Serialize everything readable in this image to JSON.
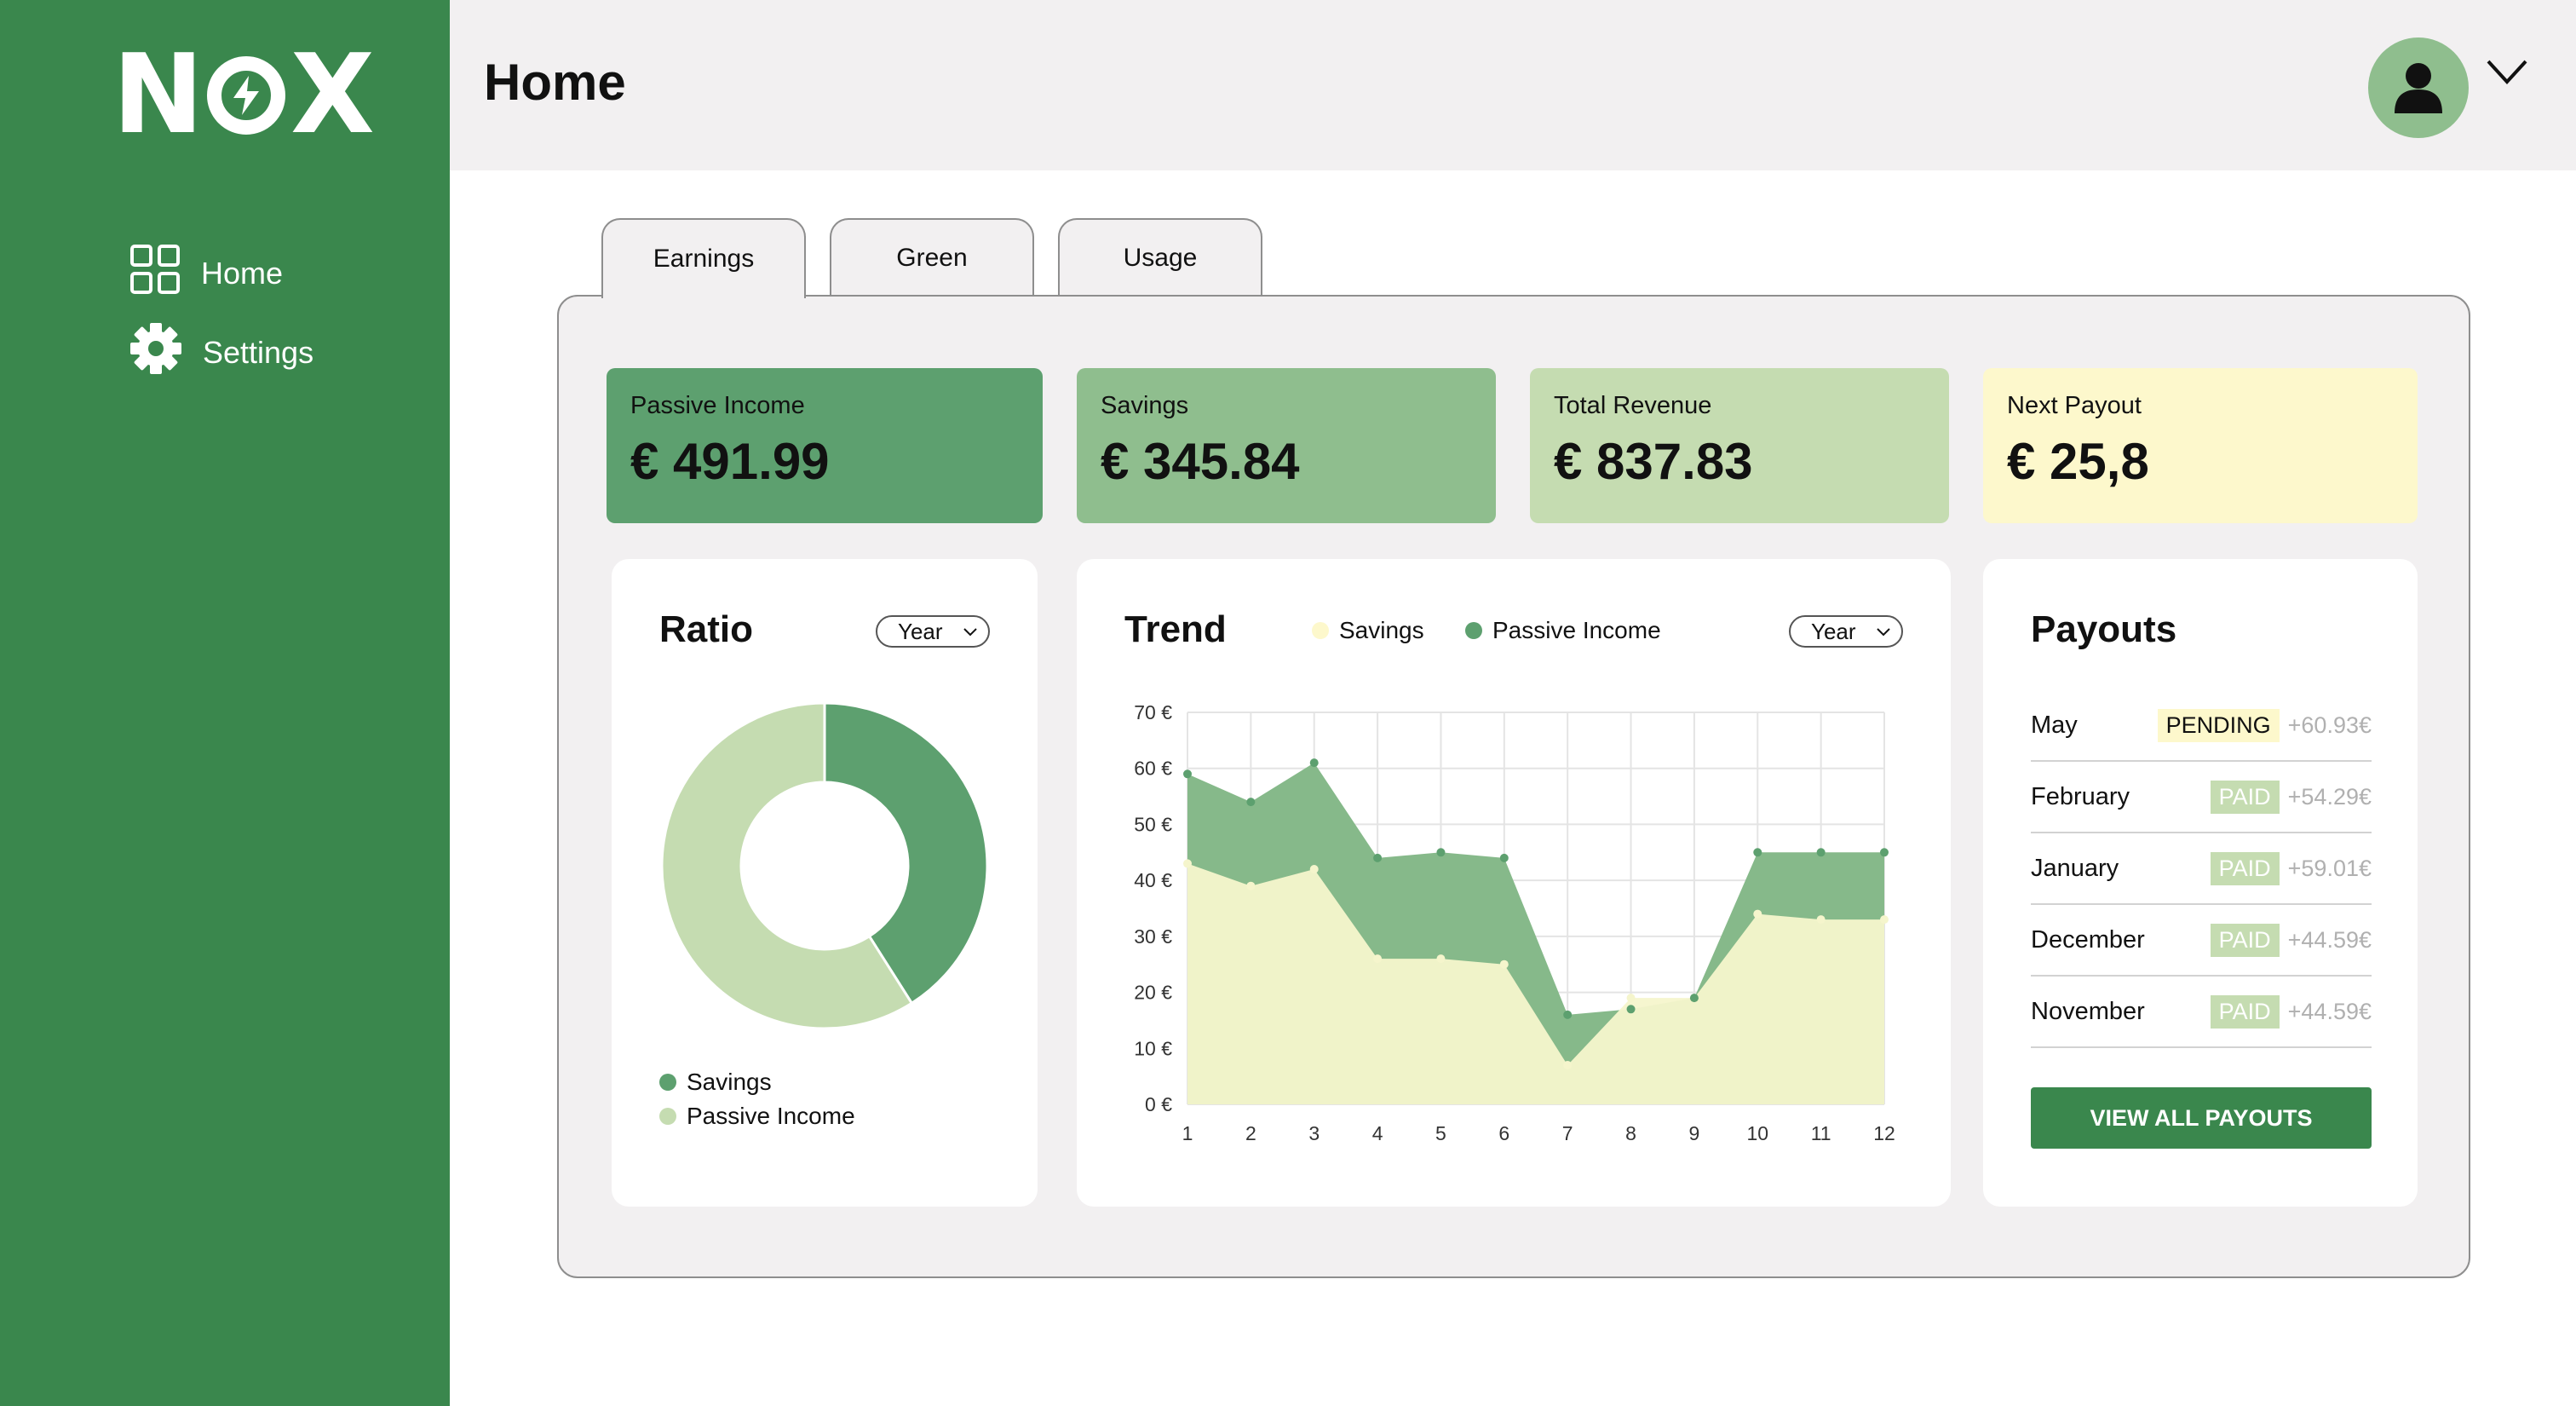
{
  "sidebar": {
    "logo": {
      "left": "N",
      "right": "X"
    },
    "items": [
      {
        "label": "Home",
        "icon": "grid-icon"
      },
      {
        "label": "Settings",
        "icon": "gear-icon"
      }
    ]
  },
  "header": {
    "title": "Home",
    "avatar_icon": "user-icon",
    "menu_icon": "chevron-down-icon"
  },
  "tabs": [
    {
      "label": "Earnings",
      "active": true
    },
    {
      "label": "Green",
      "active": false
    },
    {
      "label": "Usage",
      "active": false
    }
  ],
  "stats": [
    {
      "label": "Passive Income",
      "value": "€ 491.99"
    },
    {
      "label": "Savings",
      "value": "€ 345.84"
    },
    {
      "label": "Total Revenue",
      "value": "€ 837.83"
    },
    {
      "label": "Next Payout",
      "value": "€ 25,8"
    }
  ],
  "ratio": {
    "title": "Ratio",
    "period": "Year"
  },
  "trend": {
    "title": "Trend",
    "period": "Year"
  },
  "colors": {
    "savings": "#f5f5cc",
    "passive_income": "#5da06f",
    "ratio_savings": "#5da06f",
    "ratio_passive": "#c5dcb1"
  },
  "payouts": {
    "title": "Payouts",
    "rows": [
      {
        "month": "May",
        "status": "PENDING",
        "amount": "+60.93€"
      },
      {
        "month": "February",
        "status": "PAID",
        "amount": "+54.29€"
      },
      {
        "month": "January",
        "status": "PAID",
        "amount": "+59.01€"
      },
      {
        "month": "December",
        "status": "PAID",
        "amount": "+44.59€"
      },
      {
        "month": "November",
        "status": "PAID",
        "amount": "+44.59€"
      }
    ],
    "button": "VIEW ALL PAYOUTS"
  },
  "chart_data": [
    {
      "type": "pie",
      "title": "Ratio",
      "labels": [
        "Savings",
        "Passive Income"
      ],
      "values": [
        41,
        59
      ]
    },
    {
      "type": "area",
      "title": "Trend",
      "x": [
        1,
        2,
        3,
        4,
        5,
        6,
        7,
        8,
        9,
        10,
        11,
        12
      ],
      "series": [
        {
          "name": "Savings",
          "values": [
            43,
            39,
            42,
            26,
            26,
            25,
            7,
            19,
            19,
            34,
            33,
            33
          ]
        },
        {
          "name": "Passive Income",
          "values": [
            59,
            54,
            61,
            44,
            45,
            44,
            16,
            17,
            19,
            45,
            45,
            45
          ]
        }
      ],
      "ylim": [
        0,
        70
      ],
      "yticks": [
        "0 €",
        "10 €",
        "20 €",
        "30 €",
        "40 €",
        "50 €",
        "60 €",
        "70 €"
      ],
      "grid": true,
      "legend": "top"
    }
  ]
}
